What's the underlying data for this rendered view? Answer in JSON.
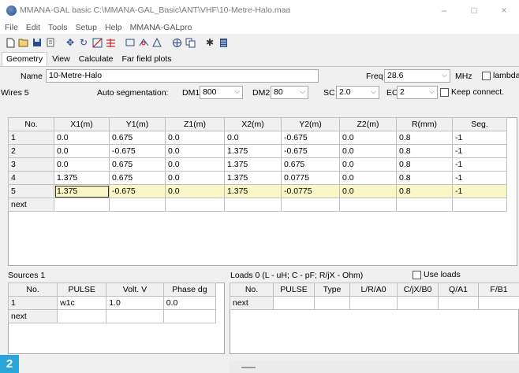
{
  "window": {
    "title": "MMANA-GAL basic C:\\MMANA-GAL_Basic\\ANT\\VHF\\10-Metre-Halo.maa",
    "minimize": "–",
    "maximize": "□",
    "close": "×"
  },
  "menu": [
    "File",
    "Edit",
    "Tools",
    "Setup",
    "Help",
    "MMANA-GALpro"
  ],
  "tabs": [
    "Geometry",
    "View",
    "Calculate",
    "Far field plots"
  ],
  "geometry": {
    "name_label": "Name",
    "name_value": "10-Metre-Halo",
    "freq_label": "Freq",
    "freq_value": "28.6",
    "mhz_label": "MHz",
    "lambda_label": "lambda",
    "wires_label": "Wires 5",
    "autoseg_label": "Auto segmentation:",
    "dm1_label": "DM1",
    "dm1_value": "800",
    "dm2_label": "DM2",
    "dm2_value": "80",
    "sc_label": "SC",
    "sc_value": "2.0",
    "ec_label": "EC",
    "ec_value": "2",
    "keep_label": "Keep connect."
  },
  "wires": {
    "headers": [
      "No.",
      "X1(m)",
      "Y1(m)",
      "Z1(m)",
      "X2(m)",
      "Y2(m)",
      "Z2(m)",
      "R(mm)",
      "Seg."
    ],
    "rows": [
      [
        "1",
        "0.0",
        "0.675",
        "0.0",
        "0.0",
        "-0.675",
        "0.0",
        "0.8",
        "-1"
      ],
      [
        "2",
        "0.0",
        "-0.675",
        "0.0",
        "1.375",
        "-0.675",
        "0.0",
        "0.8",
        "-1"
      ],
      [
        "3",
        "0.0",
        "0.675",
        "0.0",
        "1.375",
        "0.675",
        "0.0",
        "0.8",
        "-1"
      ],
      [
        "4",
        "1.375",
        "0.675",
        "0.0",
        "1.375",
        "0.0775",
        "0.0",
        "0.8",
        "-1"
      ],
      [
        "5",
        "1.375",
        "-0.675",
        "0.0",
        "1.375",
        "-0.0775",
        "0.0",
        "0.8",
        "-1"
      ]
    ],
    "next_label": "next"
  },
  "sources": {
    "title": "Sources 1",
    "headers": [
      "No.",
      "PULSE",
      "Volt. V",
      "Phase dg"
    ],
    "rows": [
      [
        "1",
        "w1c",
        "1.0",
        "0.0"
      ]
    ],
    "next_label": "next"
  },
  "loads": {
    "title": "Loads 0 (L - uH; C - pF; R/jX - Ohm)",
    "use_loads_label": "Use loads",
    "headers": [
      "No.",
      "PULSE",
      "Type",
      "L/R/A0",
      "C/jX/B0",
      "Q/A1",
      "F/B1"
    ],
    "next_label": "next"
  },
  "figure_badge": "2"
}
